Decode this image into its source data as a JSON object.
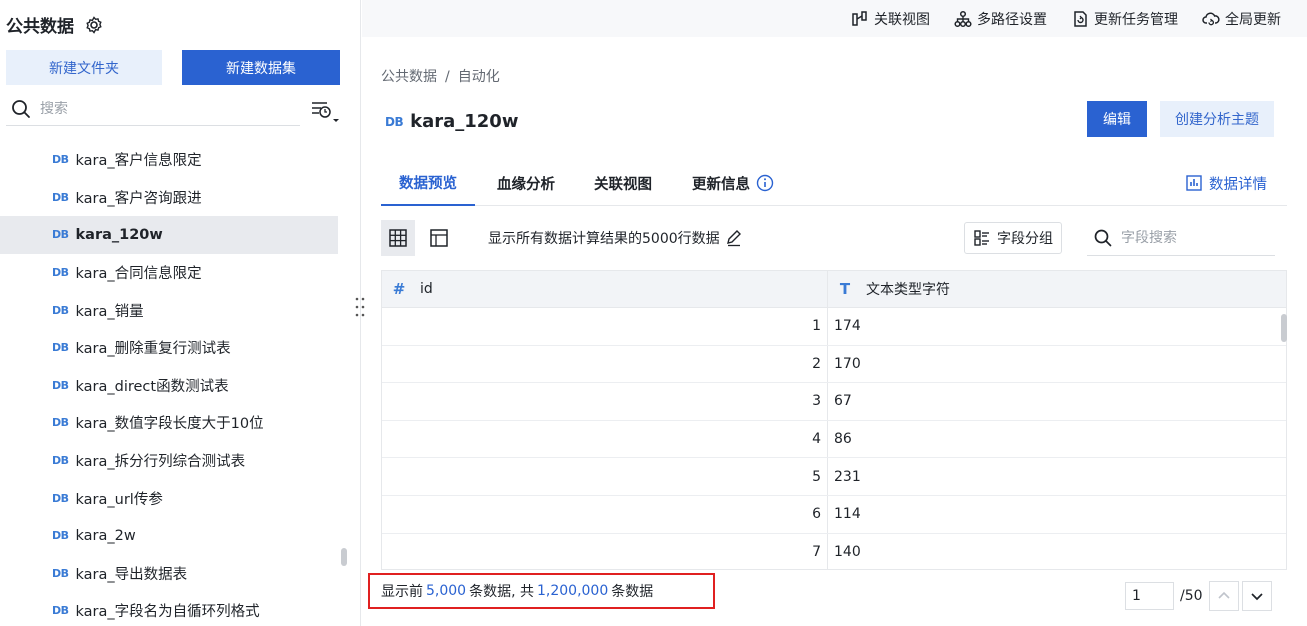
{
  "sidebar": {
    "title": "公共数据",
    "new_folder_label": "新建文件夹",
    "new_dataset_label": "新建数据集",
    "search_placeholder": "搜索",
    "db_tag": "DB",
    "items": [
      {
        "label": "kara_客户信息限定",
        "active": false
      },
      {
        "label": "kara_客户咨询跟进",
        "active": false
      },
      {
        "label": "kara_120w",
        "active": true
      },
      {
        "label": "kara_合同信息限定",
        "active": false
      },
      {
        "label": "kara_销量",
        "active": false
      },
      {
        "label": "kara_删除重复行测试表",
        "active": false
      },
      {
        "label": "kara_direct函数测试表",
        "active": false
      },
      {
        "label": "kara_数值字段长度大于10位",
        "active": false
      },
      {
        "label": "kara_拆分行列综合测试表",
        "active": false
      },
      {
        "label": "kara_url传参",
        "active": false
      },
      {
        "label": "kara_2w",
        "active": false
      },
      {
        "label": "kara_导出数据表",
        "active": false
      },
      {
        "label": "kara_字段名为自循环列格式",
        "active": false
      }
    ]
  },
  "topbar": {
    "related_view": "关联视图",
    "multipath": "多路径设置",
    "update_tasks": "更新任务管理",
    "global_update": "全局更新"
  },
  "breadcrumb": {
    "root": "公共数据",
    "sep": "/",
    "current": "自动化"
  },
  "dataset": {
    "tag": "DB",
    "name": "kara_120w"
  },
  "actions": {
    "edit": "编辑",
    "create_topic": "创建分析主题"
  },
  "tabs": {
    "preview": "数据预览",
    "lineage": "血缘分析",
    "related": "关联视图",
    "update_info": "更新信息",
    "details": "数据详情"
  },
  "toolbar": {
    "description": "显示所有数据计算结果的5000行数据",
    "field_group": "字段分组",
    "field_search_placeholder": "字段搜索"
  },
  "table": {
    "columns": [
      {
        "icon": "#",
        "name": "id"
      },
      {
        "icon": "T",
        "name": "文本类型字符"
      }
    ],
    "rows": [
      [
        "1",
        "174"
      ],
      [
        "2",
        "170"
      ],
      [
        "3",
        "67"
      ],
      [
        "4",
        "86"
      ],
      [
        "5",
        "231"
      ],
      [
        "6",
        "114"
      ],
      [
        "7",
        "140"
      ]
    ]
  },
  "footer": {
    "prefix": "显示前",
    "shown": "5,000",
    "middle": "条数据, 共",
    "total": "1,200,000",
    "suffix": "条数据",
    "page_value": "1",
    "page_total": "/50"
  },
  "colors": {
    "primary": "#2a62d1",
    "highlight_border": "#e02020"
  }
}
